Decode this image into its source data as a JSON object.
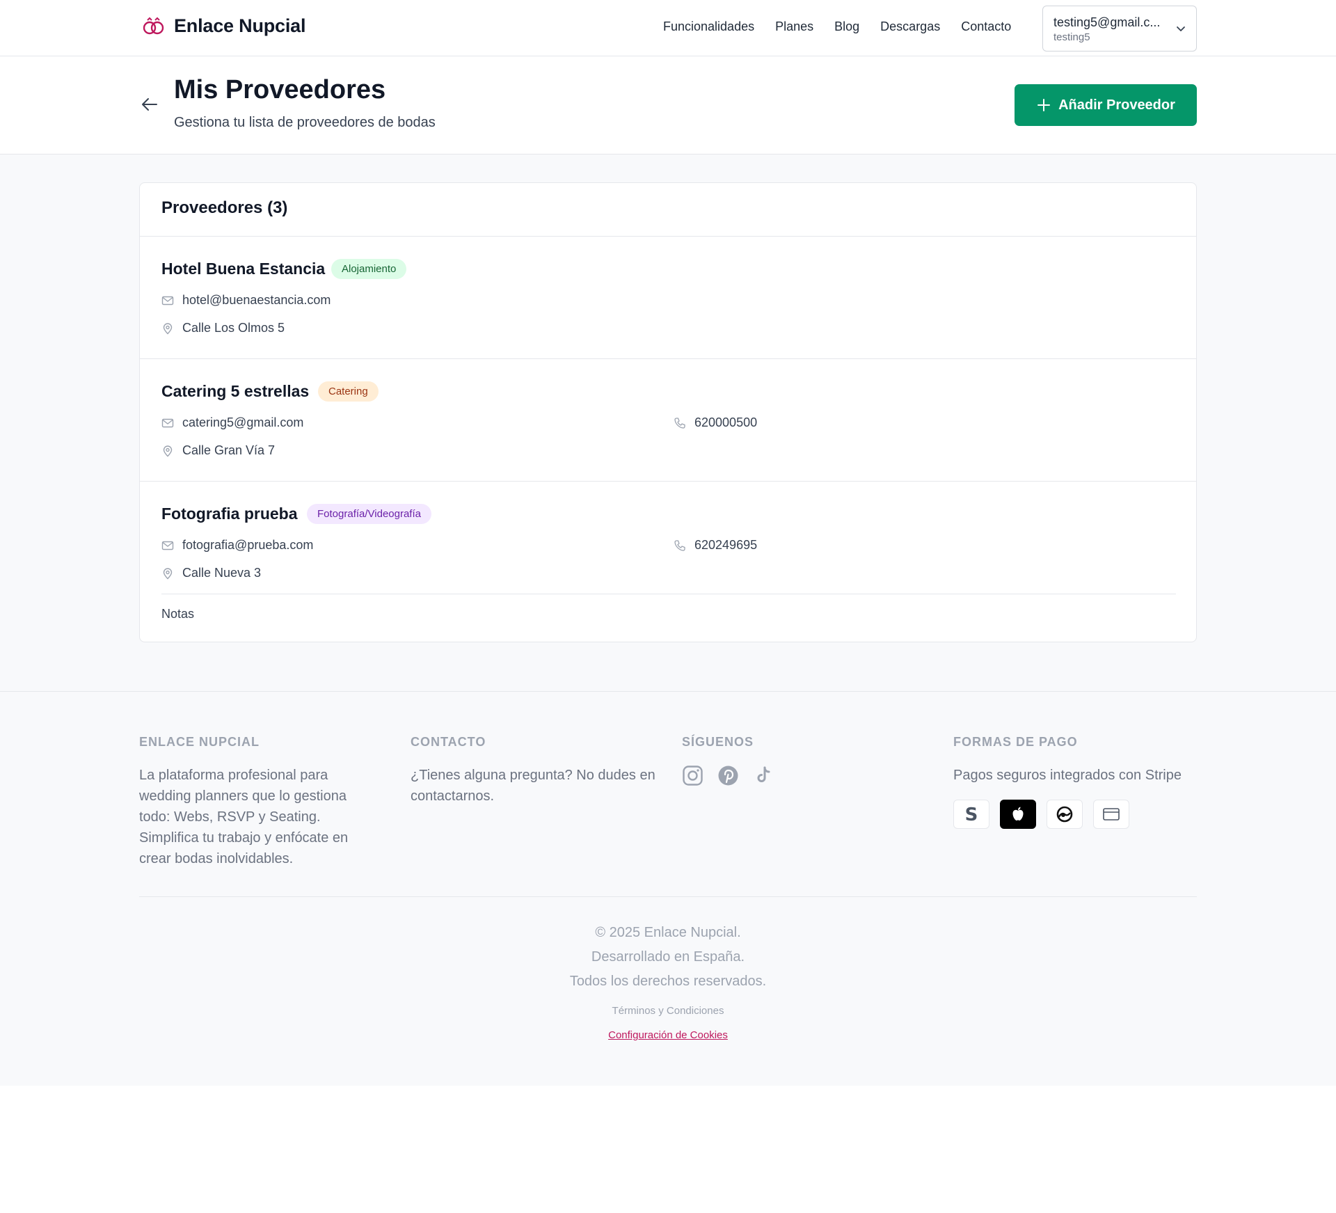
{
  "header": {
    "brand": "Enlace Nupcial",
    "nav": [
      "Funcionalidades",
      "Planes",
      "Blog",
      "Descargas",
      "Contacto"
    ],
    "user_email": "testing5@gmail.c...",
    "user_name": "testing5"
  },
  "page": {
    "title": "Mis Proveedores",
    "subtitle": "Gestiona tu lista de proveedores de bodas",
    "add_button": "Añadir Proveedor"
  },
  "providers_card": {
    "title": "Proveedores (3)",
    "providers": [
      {
        "name": "Hotel Buena Estancia",
        "category": "Alojamiento",
        "email": "hotel@buenaestancia.com",
        "address": "Calle Los Olmos 5"
      },
      {
        "name": "Catering 5 estrellas",
        "category": "Catering",
        "email": "catering5@gmail.com",
        "phone": "620000500",
        "address": "Calle Gran Vía 7"
      },
      {
        "name": "Fotografia prueba",
        "category": "Fotografía/Videografía",
        "email": "fotografia@prueba.com",
        "phone": "620249695",
        "address": "Calle Nueva 3",
        "notes_label": "Notas"
      }
    ]
  },
  "footer": {
    "about_heading": "ENLACE NUPCIAL",
    "about_text": "La plataforma profesional para wedding planners que lo gestiona todo: Webs, RSVP y Seating. Simplifica tu trabajo y enfócate en crear bodas inolvidables.",
    "contact_heading": "CONTACTO",
    "contact_text": "¿Tienes alguna pregunta? No dudes en contactarnos.",
    "social_heading": "SÍGUENOS",
    "social_icons": [
      "instagram-icon",
      "pinterest-icon",
      "tiktok-icon"
    ],
    "payment_heading": "FORMAS DE PAGO",
    "payment_text": "Pagos seguros integrados con Stripe",
    "payment_icons": [
      "stripe-icon",
      "apple-pay-icon",
      "link-icon",
      "card-icon"
    ],
    "copyright_1": "© 2025 Enlace Nupcial.",
    "copyright_2": "Desarrollado en España.",
    "copyright_3": "Todos los derechos reservados.",
    "terms": "Términos y Condiciones",
    "cookies": "Configuración de Cookies"
  },
  "colors": {
    "brand_pink": "#be185d",
    "accent_green": "#059669"
  }
}
